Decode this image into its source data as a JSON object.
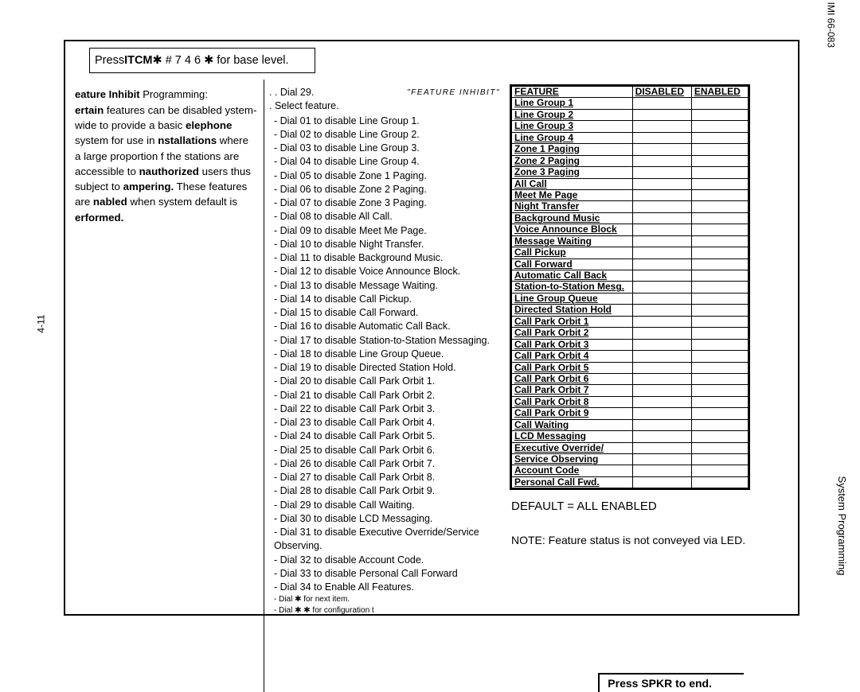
{
  "header": {
    "prefix": "Press ",
    "bold": "ITCM",
    "rest": " ✱ # 7 4 6 ✱ for base level."
  },
  "col1": {
    "title_bold": "eature Inhibit",
    "title_rest": " Programming:",
    "body_html": "ertain features can be disabled ystem-wide to provide a basic elephone system for use in nstallations where a large proportion f the stations are accessible to nauthorized users thus subject to ampering. These features are nabled when system default is erformed."
  },
  "col2": {
    "top_dot1": "Dial 29.",
    "top_quote": "\"FEATURE INHIBIT\"",
    "top_dot2": "Select feature.",
    "items": [
      "Dial 01 to disable Line Group 1.",
      "Dial 02 to disable Line Group 2.",
      "Dial 03 to disable Line Group 3.",
      "Dial 04 to disable Line Group 4.",
      "Dial 05 to disable Zone 1 Paging.",
      "Dial 06 to disable Zone 2 Paging.",
      "Dial 07 to disable Zone 3 Paging.",
      "Dial 08 to disable All Call.",
      "Dial 09 to disable Meet Me Page.",
      "Dial 10 to disable Night Transfer.",
      "Dial 11 to disable Background Music.",
      "Dial 12 to disable Voice Announce Block.",
      "Dial 13 to disable Message Waiting.",
      "Dial 14 to disable Call Pickup.",
      "Dial 15 to disable Call Forward.",
      "Dial 16 to disable Automatic Call Back.",
      "Dial 17 to disable Station-to-Station Messaging.",
      "Dial 18 to disable Line Group Queue.",
      "Dial 19 to disable Directed Station Hold.",
      "Dial 20 to disable Call Park Orbit 1.",
      "Dial 21 to disable Call Park Orbit 2.",
      "Dail 22 to disable Call Park Orbit 3.",
      "Dial 23 to disable Call Park Orbit 4.",
      "Dial 24 to disable Call Park Orbit 5.",
      "Dial 25 to disable Call Park Orbit 6.",
      "Dial 26 to disable Call Park Orbit 7.",
      "Dial 27 to disable Call Park Orbit 8.",
      "Dial 28 to disable Call Park Orbit 9.",
      "Dial 29 to disable Call Waiting.",
      "Dial 30 to disable LCD Messaging.",
      "Dial 31 to disable Executive Override/Service Observing.",
      "Dial 32 to disable Account Code.",
      "Dial 33 to disable Personal Call Forward",
      "Dial 34 to Enable All Features.",
      "Dial ✱ for next item.",
      "Dial ✱ ✱ for configuration t"
    ]
  },
  "col3": {
    "header": [
      "FEATURE",
      "DISABLED",
      "ENABLED"
    ],
    "rows": [
      "Line Group 1",
      "Line Group 2",
      "Line Group 3",
      "Line Group 4",
      "Zone 1 Paging",
      "Zone 2 Paging",
      "Zone 3 Paging",
      "All Call",
      "Meet Me Page",
      "Night Transfer",
      "Background Music",
      "Voice Announce Block",
      "Message Waiting",
      "Call Pickup",
      "Call Forward",
      "Automatic Call Back",
      "Station-to-Station Mesg.",
      "Line Group Queue",
      "Directed Station Hold",
      "Call Park Orbit 1",
      "Call Park Orbit 2",
      "Call Park Orbit 3",
      "Call Park Orbit 4",
      "Call Park Orbit 5",
      "Call Park Orbit 6",
      "Call Park Orbit 7",
      "Call Park Orbit 8",
      "Call Park Orbit 9",
      "Call Waiting",
      "LCD Messaging",
      "Executive Override/",
      "Service Observing",
      "Account Code",
      "Personal Call Fwd."
    ],
    "default_text": "DEFAULT = ALL ENABLED",
    "note_text": "NOTE: Feature status is not conveyed via LED.",
    "press_spkr": "Press SPKR to end."
  },
  "side": {
    "right_top": "IMI 66-083",
    "right_bottom": "System Programming",
    "left": "4-11"
  }
}
